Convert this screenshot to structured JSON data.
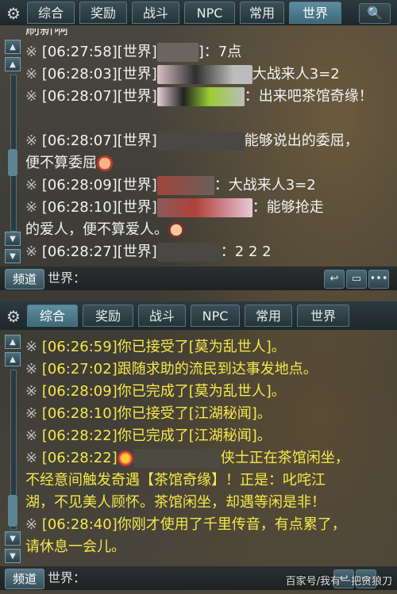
{
  "tabs": [
    "综合",
    "奖励",
    "战斗",
    "NPC",
    "常用",
    "世界"
  ],
  "panel_top": {
    "active_tab": "世界",
    "lines": [
      {
        "mark": "",
        "text": "刷新啊"
      },
      {
        "mark": "※",
        "time": "[06:27:58]",
        "ch": "[世界]",
        "after": "]：7点"
      },
      {
        "mark": "※",
        "time": "[06:28:03]",
        "ch": "[世界]",
        "after": "大战来人3=2"
      },
      {
        "mark": "※",
        "time": "[06:28:07]",
        "ch": "[世界]",
        "after": "：出来吧茶馆奇缘！"
      },
      {
        "mark": "",
        "text": ""
      },
      {
        "mark": "※",
        "time": "[06:28:07]",
        "ch": "[世界]",
        "after": "能够说出的委屈，"
      },
      {
        "mark": "",
        "text": "便不算委屈"
      },
      {
        "mark": "※",
        "time": "[06:28:09]",
        "ch": "[世界]",
        "after": "：大战来人3=2"
      },
      {
        "mark": "※",
        "time": "[06:28:10]",
        "ch": "[世界]",
        "after": "：能够抢走"
      },
      {
        "mark": "",
        "text": "的爱人，便不算爱人。"
      },
      {
        "mark": "※",
        "time": "[06:28:27]",
        "ch": "[世界]",
        "after": "：2 2 2"
      }
    ],
    "channel_btn": "频道",
    "channel_label": "世界："
  },
  "panel_bottom": {
    "active_tab": "综合",
    "lines": [
      {
        "mark": "※",
        "time": "[06:26:59]",
        "msg": "你已接受了[莫为乱世人]。"
      },
      {
        "mark": "※",
        "time": "[06:27:02]",
        "msg": "跟随求助的流民到达事发地点。"
      },
      {
        "mark": "※",
        "time": "[06:28:09]",
        "msg": "你已完成了[莫为乱世人]。"
      },
      {
        "mark": "※",
        "time": "[06:28:10]",
        "msg": "你已接受了[江湖秘闻]。"
      },
      {
        "mark": "※",
        "time": "[06:28:22]",
        "msg": "你已完成了[江湖秘闻]。"
      },
      {
        "mark": "※",
        "time": "[06:28:22]",
        "msg": "侠士正在茶馆闲坐，"
      },
      {
        "mark": "",
        "time": "",
        "msg": "不经意间触发奇遇【茶馆奇缘】！正是：叱咤江"
      },
      {
        "mark": "",
        "time": "",
        "msg": "湖，不见美人顾怀。茶馆闲坐，却遇等闲是非！"
      },
      {
        "mark": "※",
        "time": "[06:28:40]",
        "msg": "你刚才使用了千里传音，有点累了，"
      },
      {
        "mark": "",
        "time": "",
        "msg": "请休息一会儿。"
      }
    ],
    "channel_btn": "频道",
    "channel_label": "世界："
  },
  "watermark": "百家号/我有一把贪狼刀",
  "colors": {
    "top_text": "#f2f2f2",
    "bottom_text": "#f5e84a",
    "active_tab": "#4d7f90"
  },
  "icons": {
    "gear": "gear-icon",
    "search": "search-icon",
    "reply": "reply-icon",
    "chat": "chat-bubble-icon",
    "more": "more-icon"
  }
}
